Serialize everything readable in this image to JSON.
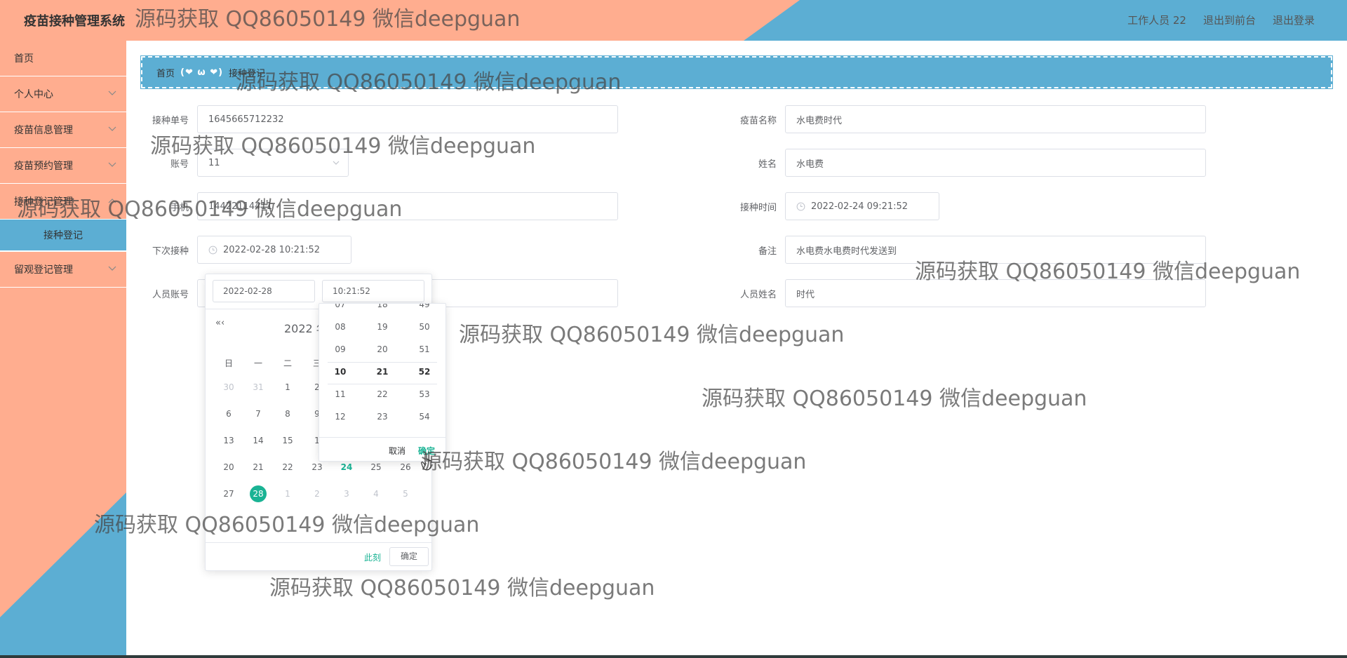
{
  "header": {
    "title": "疫苗接种管理系统",
    "links": [
      "工作人员 22",
      "退出到前台",
      "退出登录"
    ]
  },
  "sidebar": {
    "items": [
      {
        "label": "首页",
        "has_children": false
      },
      {
        "label": "个人中心",
        "has_children": true
      },
      {
        "label": "疫苗信息管理",
        "has_children": true
      },
      {
        "label": "疫苗预约管理",
        "has_children": true
      },
      {
        "label": "接种登记管理",
        "has_children": true
      },
      {
        "label": "留观登记管理",
        "has_children": true
      }
    ],
    "active_sub": "接种登记"
  },
  "breadcrumb": {
    "home": "首页",
    "separator": "(❤ ω ❤)",
    "current": "接种登记"
  },
  "form": {
    "left": [
      {
        "label": "接种单号",
        "value": "1645665712232"
      },
      {
        "label": "账号",
        "value": "11"
      },
      {
        "label": "手机",
        "value": "14422114411"
      },
      {
        "label": "下次接种",
        "value": "2022-02-28 10:21:52"
      },
      {
        "label": "人员账号",
        "value": ""
      }
    ],
    "right": [
      {
        "label": "疫苗名称",
        "value": "水电费时代"
      },
      {
        "label": "姓名",
        "value": "水电费"
      },
      {
        "label": "接种时间",
        "value": "2022-02-24 09:21:52"
      },
      {
        "label": "备注",
        "value": "水电费水电费时代发送到"
      },
      {
        "label": "人员姓名",
        "value": "时代"
      }
    ]
  },
  "picker": {
    "date_input": "2022-02-28",
    "time_input": "10:21:52",
    "nav_prev": "«‹",
    "title": "2022 年",
    "weekdays": [
      "日",
      "一",
      "二",
      "三"
    ],
    "rows": [
      [
        "30",
        "31",
        "1",
        "2"
      ],
      [
        "6",
        "7",
        "8",
        "9"
      ],
      [
        "13",
        "14",
        "15",
        "1"
      ],
      [
        "20",
        "21",
        "22",
        "23",
        "24",
        "25",
        "26"
      ],
      [
        "27",
        "28",
        "1",
        "2",
        "3",
        "4",
        "5"
      ]
    ],
    "now_label": "此刻",
    "ok_label": "确定",
    "accent": "#1ab394"
  },
  "time_spinner": {
    "hours": [
      "07",
      "08",
      "09",
      "10",
      "11",
      "12"
    ],
    "minutes": [
      "18",
      "19",
      "20",
      "21",
      "22",
      "23"
    ],
    "seconds": [
      "49",
      "50",
      "51",
      "52",
      "53",
      "54"
    ],
    "cancel_label": "取消",
    "ok_label": "确定"
  },
  "watermark": "源码获取 QQ86050149 微信deepguan"
}
